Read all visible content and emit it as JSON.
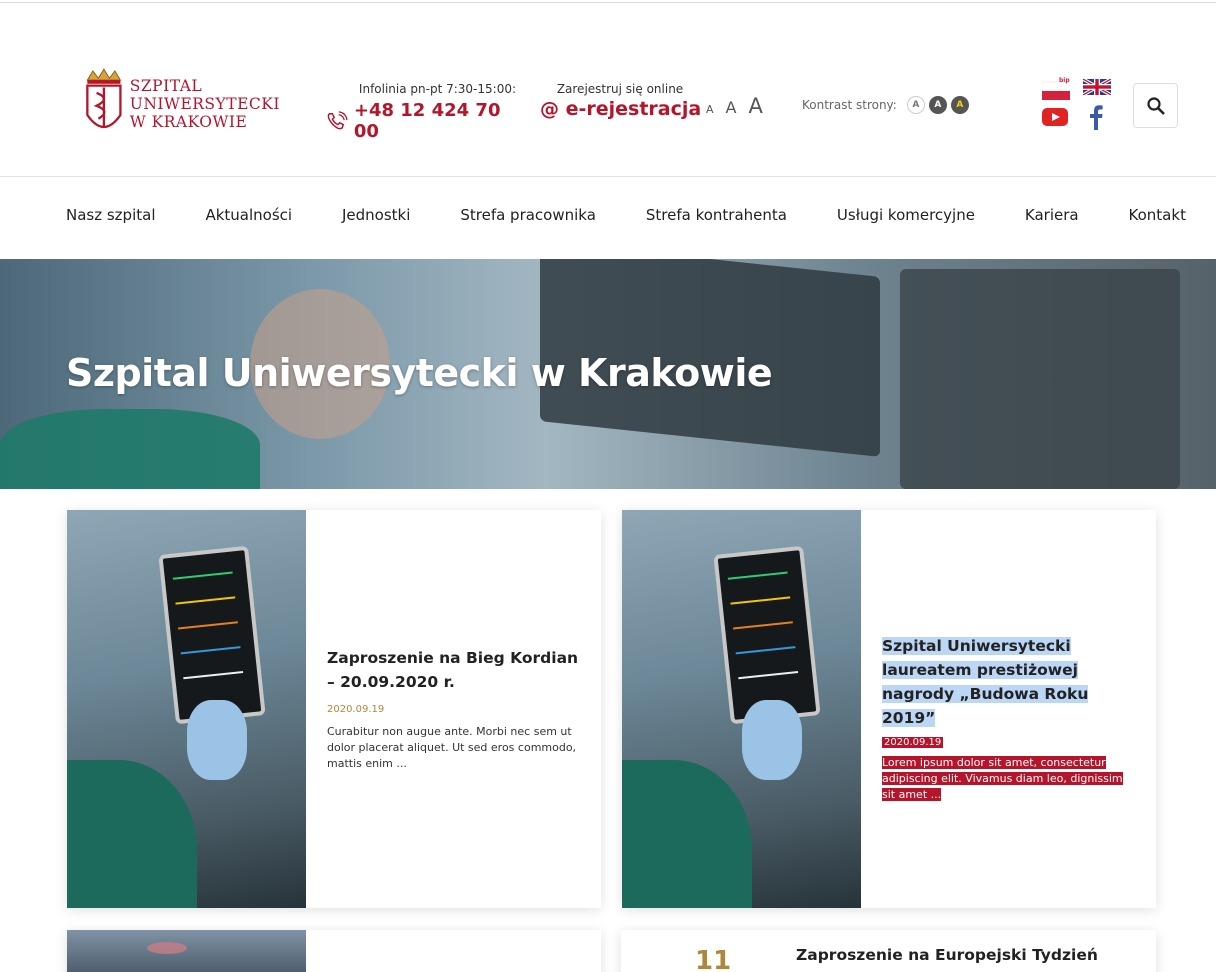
{
  "header": {
    "logo_line1": "SZPITAL",
    "logo_line2": "UNIWERSYTECKI",
    "logo_line3": "W KRAKOWIE",
    "infolinia_label": "Infolinia pn-pt 7:30-15:00:",
    "phone": "+48 12 424 70 00",
    "ereg_label": "Zarejestruj się online",
    "ereg_link": "@ e-rejestracja",
    "font_small": "A",
    "font_medium": "A",
    "font_large": "A",
    "contrast_label": "Kontrast strony:",
    "contrast_1": "A",
    "contrast_2": "A",
    "contrast_3": "A",
    "bip_label": "bip"
  },
  "nav": [
    "Nasz szpital",
    "Aktualności",
    "Jednostki",
    "Strefa pracownika",
    "Strefa kontrahenta",
    "Usługi komercyjne",
    "Kariera",
    "Kontakt"
  ],
  "hero": {
    "title": "Szpital Uniwersytecki w Krakowie"
  },
  "cards": [
    {
      "title": "Zaproszenie na Bieg Kordian – 20.09.2020 r.",
      "date": "2020.09.19",
      "text": "Curabitur non augue ante. Morbi nec sem ut dolor placerat aliquet. Ut sed eros commodo, mattis enim ..."
    },
    {
      "title": "Szpital Uniwersytecki laureatem prestiżowej nagrody „Budowa Roku 2019”",
      "date": "2020.09.19",
      "text": "Lorem ipsum dolor sit amet, consectetur adipiscing elit. Vivamus diam leo, dignissim sit amet ..."
    }
  ],
  "card3_partial": {
    "day": "11",
    "title": "Zaproszenie na Europejski Tydzień"
  },
  "colors": {
    "brand": "#b5142b",
    "date": "#b0873a",
    "selection": "#bcd6f5"
  }
}
